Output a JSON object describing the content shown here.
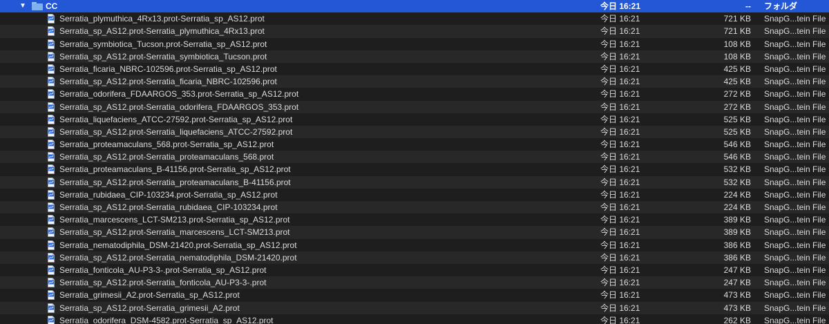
{
  "folder": {
    "name": "CC",
    "date": "今日 16:21",
    "size": "--",
    "kind": "フォルダ",
    "disclosure_glyph": "▼"
  },
  "colors": {
    "selection": "#2457d6",
    "row": "#1e1e1e",
    "row_alt": "#282828",
    "text": "#dcdcdc"
  },
  "files": [
    {
      "name": "Serratia_plymuthica_4Rx13.prot-Serratia_sp_AS12.prot",
      "date": "今日 16:21",
      "size": "721 KB",
      "kind": "SnapG...tein File"
    },
    {
      "name": "Serratia_sp_AS12.prot-Serratia_plymuthica_4Rx13.prot",
      "date": "今日 16:21",
      "size": "721 KB",
      "kind": "SnapG...tein File"
    },
    {
      "name": "Serratia_symbiotica_Tucson.prot-Serratia_sp_AS12.prot",
      "date": "今日 16:21",
      "size": "108 KB",
      "kind": "SnapG...tein File"
    },
    {
      "name": "Serratia_sp_AS12.prot-Serratia_symbiotica_Tucson.prot",
      "date": "今日 16:21",
      "size": "108 KB",
      "kind": "SnapG...tein File"
    },
    {
      "name": "Serratia_ficaria_NBRC-102596.prot-Serratia_sp_AS12.prot",
      "date": "今日 16:21",
      "size": "425 KB",
      "kind": "SnapG...tein File"
    },
    {
      "name": "Serratia_sp_AS12.prot-Serratia_ficaria_NBRC-102596.prot",
      "date": "今日 16:21",
      "size": "425 KB",
      "kind": "SnapG...tein File"
    },
    {
      "name": "Serratia_odorifera_FDAARGOS_353.prot-Serratia_sp_AS12.prot",
      "date": "今日 16:21",
      "size": "272 KB",
      "kind": "SnapG...tein File"
    },
    {
      "name": "Serratia_sp_AS12.prot-Serratia_odorifera_FDAARGOS_353.prot",
      "date": "今日 16:21",
      "size": "272 KB",
      "kind": "SnapG...tein File"
    },
    {
      "name": "Serratia_liquefaciens_ATCC-27592.prot-Serratia_sp_AS12.prot",
      "date": "今日 16:21",
      "size": "525 KB",
      "kind": "SnapG...tein File"
    },
    {
      "name": "Serratia_sp_AS12.prot-Serratia_liquefaciens_ATCC-27592.prot",
      "date": "今日 16:21",
      "size": "525 KB",
      "kind": "SnapG...tein File"
    },
    {
      "name": "Serratia_proteamaculans_568.prot-Serratia_sp_AS12.prot",
      "date": "今日 16:21",
      "size": "546 KB",
      "kind": "SnapG...tein File"
    },
    {
      "name": "Serratia_sp_AS12.prot-Serratia_proteamaculans_568.prot",
      "date": "今日 16:21",
      "size": "546 KB",
      "kind": "SnapG...tein File"
    },
    {
      "name": "Serratia_proteamaculans_B-41156.prot-Serratia_sp_AS12.prot",
      "date": "今日 16:21",
      "size": "532 KB",
      "kind": "SnapG...tein File"
    },
    {
      "name": "Serratia_sp_AS12.prot-Serratia_proteamaculans_B-41156.prot",
      "date": "今日 16:21",
      "size": "532 KB",
      "kind": "SnapG...tein File"
    },
    {
      "name": "Serratia_rubidaea_CIP-103234.prot-Serratia_sp_AS12.prot",
      "date": "今日 16:21",
      "size": "224 KB",
      "kind": "SnapG...tein File"
    },
    {
      "name": "Serratia_sp_AS12.prot-Serratia_rubidaea_CIP-103234.prot",
      "date": "今日 16:21",
      "size": "224 KB",
      "kind": "SnapG...tein File"
    },
    {
      "name": "Serratia_marcescens_LCT-SM213.prot-Serratia_sp_AS12.prot",
      "date": "今日 16:21",
      "size": "389 KB",
      "kind": "SnapG...tein File"
    },
    {
      "name": "Serratia_sp_AS12.prot-Serratia_marcescens_LCT-SM213.prot",
      "date": "今日 16:21",
      "size": "389 KB",
      "kind": "SnapG...tein File"
    },
    {
      "name": "Serratia_nematodiphila_DSM-21420.prot-Serratia_sp_AS12.prot",
      "date": "今日 16:21",
      "size": "386 KB",
      "kind": "SnapG...tein File"
    },
    {
      "name": "Serratia_sp_AS12.prot-Serratia_nematodiphila_DSM-21420.prot",
      "date": "今日 16:21",
      "size": "386 KB",
      "kind": "SnapG...tein File"
    },
    {
      "name": "Serratia_fonticola_AU-P3-3-.prot-Serratia_sp_AS12.prot",
      "date": "今日 16:21",
      "size": "247 KB",
      "kind": "SnapG...tein File"
    },
    {
      "name": "Serratia_sp_AS12.prot-Serratia_fonticola_AU-P3-3-.prot",
      "date": "今日 16:21",
      "size": "247 KB",
      "kind": "SnapG...tein File"
    },
    {
      "name": "Serratia_grimesii_A2.prot-Serratia_sp_AS12.prot",
      "date": "今日 16:21",
      "size": "473 KB",
      "kind": "SnapG...tein File"
    },
    {
      "name": "Serratia_sp_AS12.prot-Serratia_grimesii_A2.prot",
      "date": "今日 16:21",
      "size": "473 KB",
      "kind": "SnapG...tein File"
    },
    {
      "name": "Serratia_odorifera_DSM-4582.prot-Serratia_sp_AS12.prot",
      "date": "今日 16:21",
      "size": "262 KB",
      "kind": "SnapG...tein File"
    }
  ]
}
